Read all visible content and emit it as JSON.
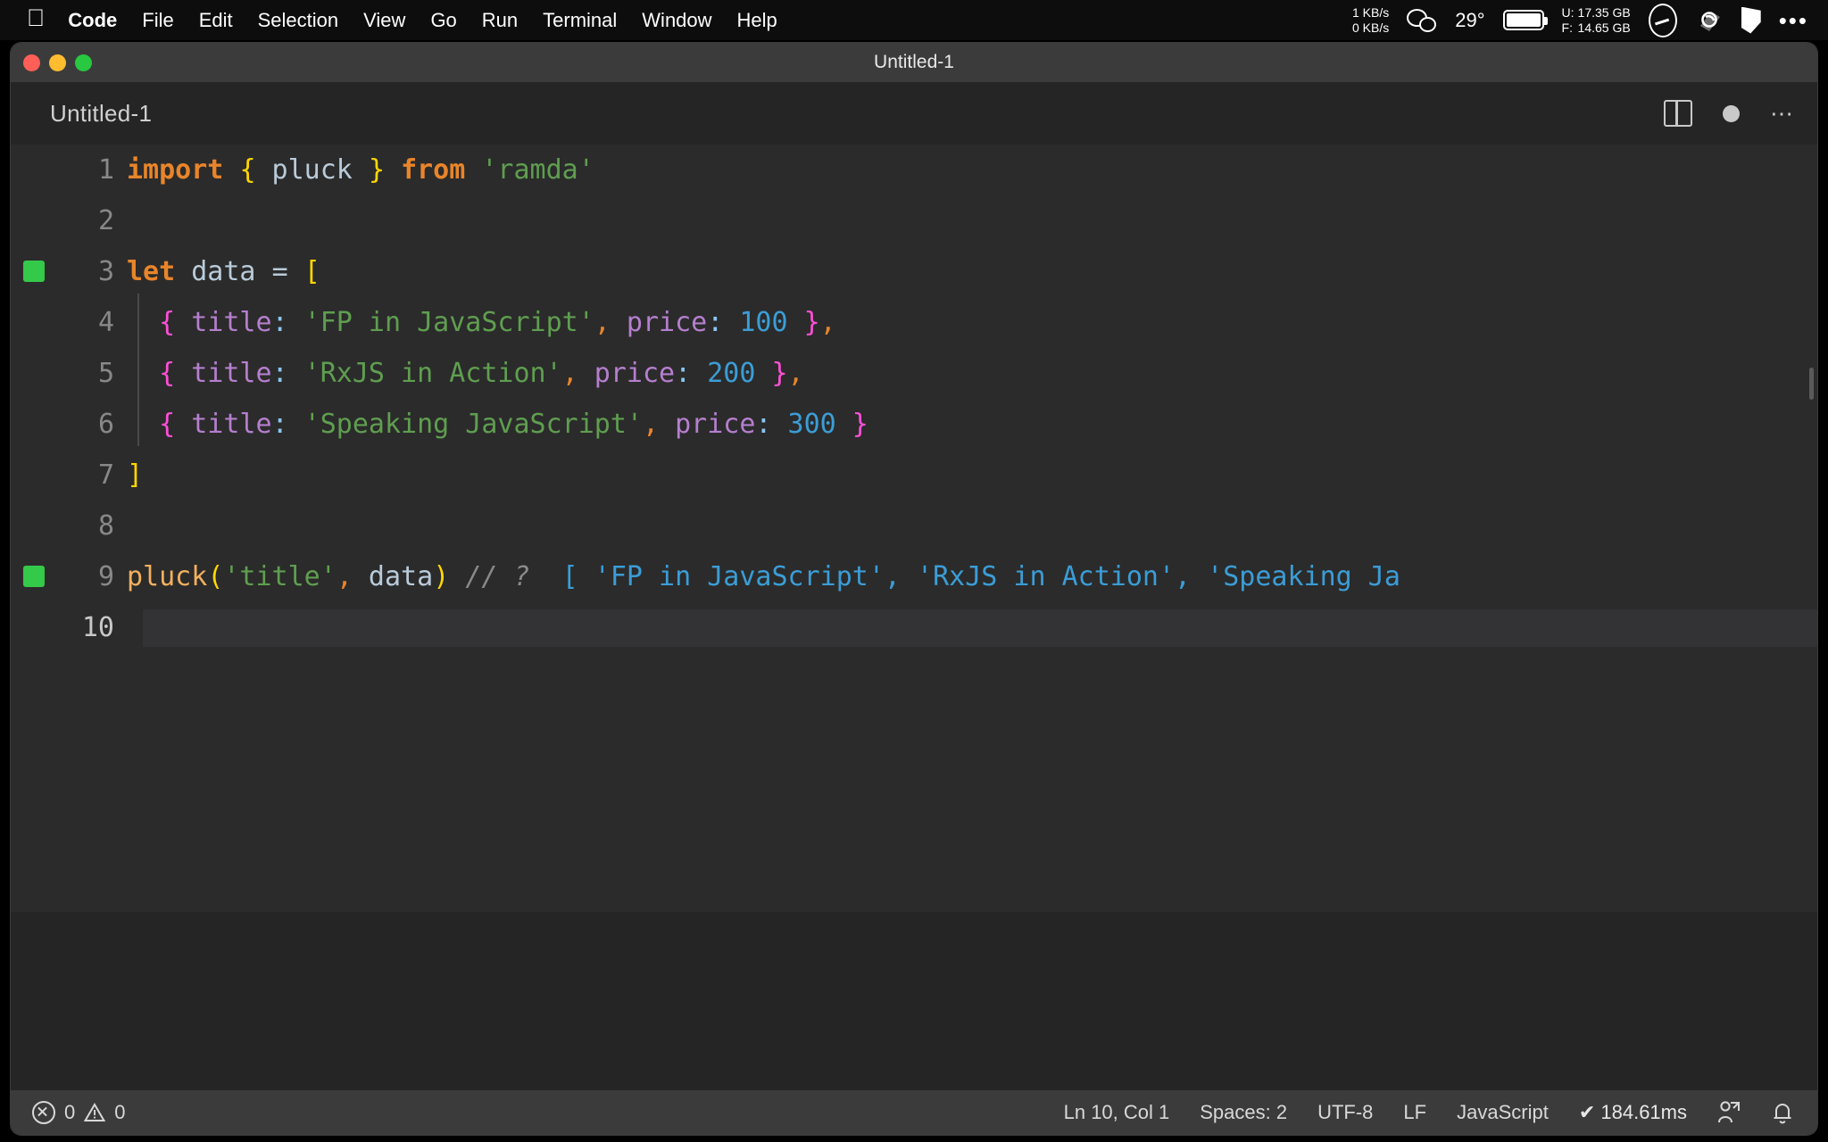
{
  "macbar": {
    "apple_logo": "apple-icon",
    "menus": [
      {
        "label": "Code",
        "bold": true
      },
      {
        "label": "File",
        "bold": false
      },
      {
        "label": "Edit",
        "bold": false
      },
      {
        "label": "Selection",
        "bold": false
      },
      {
        "label": "View",
        "bold": false
      },
      {
        "label": "Go",
        "bold": false
      },
      {
        "label": "Run",
        "bold": false
      },
      {
        "label": "Terminal",
        "bold": false
      },
      {
        "label": "Window",
        "bold": false
      },
      {
        "label": "Help",
        "bold": false
      }
    ],
    "net_up": "1 KB/s",
    "net_down": "0 KB/s",
    "wechat": "wechat-icon",
    "temperature": "29°",
    "battery": "battery-icon",
    "disk_used_label": "U:",
    "disk_used_value": "17.35 GB",
    "disk_free_label": "F:",
    "disk_free_value": "14.65 GB",
    "ellipse": "ellipse-icon",
    "link": "link-icon",
    "flag": "flag-icon",
    "more": "•••"
  },
  "window": {
    "title": "Untitled-1",
    "tab_name": "Untitled-1",
    "traffic_lights": [
      "close",
      "minimize",
      "zoom"
    ],
    "actions": [
      "split-editor",
      "unsaved-dot",
      "more-actions"
    ]
  },
  "editor": {
    "lines": [
      {
        "no": "1",
        "breakpoint": false,
        "current": false,
        "indent_guide": false,
        "tokens": [
          {
            "t": "import",
            "c": "t-kw"
          },
          {
            "t": " ",
            "c": "t-punc"
          },
          {
            "t": "{",
            "c": "b-yellow"
          },
          {
            "t": " pluck ",
            "c": "t-var"
          },
          {
            "t": "}",
            "c": "b-yellow"
          },
          {
            "t": " ",
            "c": "t-punc"
          },
          {
            "t": "from",
            "c": "t-kw"
          },
          {
            "t": " ",
            "c": "t-punc"
          },
          {
            "t": "'ramda'",
            "c": "t-str"
          }
        ]
      },
      {
        "no": "2",
        "breakpoint": false,
        "current": false,
        "indent_guide": false,
        "tokens": []
      },
      {
        "no": "3",
        "breakpoint": true,
        "current": false,
        "indent_guide": false,
        "tokens": [
          {
            "t": "let",
            "c": "t-kw"
          },
          {
            "t": " data ",
            "c": "t-var"
          },
          {
            "t": "=",
            "c": "t-punc"
          },
          {
            "t": " ",
            "c": "t-punc"
          },
          {
            "t": "[",
            "c": "b-yellow"
          }
        ]
      },
      {
        "no": "4",
        "breakpoint": false,
        "current": false,
        "indent_guide": true,
        "tokens": [
          {
            "t": "  ",
            "c": "t-punc"
          },
          {
            "t": "{",
            "c": "b-magenta"
          },
          {
            "t": " ",
            "c": "t-punc"
          },
          {
            "t": "title",
            "c": "t-prop"
          },
          {
            "t": ":",
            "c": "b-blue"
          },
          {
            "t": " ",
            "c": "t-punc"
          },
          {
            "t": "'FP in JavaScript'",
            "c": "t-str"
          },
          {
            "t": ",",
            "c": "t-comma"
          },
          {
            "t": " ",
            "c": "t-punc"
          },
          {
            "t": "price",
            "c": "t-prop"
          },
          {
            "t": ":",
            "c": "b-blue"
          },
          {
            "t": " ",
            "c": "t-punc"
          },
          {
            "t": "100",
            "c": "t-num"
          },
          {
            "t": " ",
            "c": "t-punc"
          },
          {
            "t": "}",
            "c": "b-magenta"
          },
          {
            "t": ",",
            "c": "t-comma"
          }
        ]
      },
      {
        "no": "5",
        "breakpoint": false,
        "current": false,
        "indent_guide": true,
        "tokens": [
          {
            "t": "  ",
            "c": "t-punc"
          },
          {
            "t": "{",
            "c": "b-magenta"
          },
          {
            "t": " ",
            "c": "t-punc"
          },
          {
            "t": "title",
            "c": "t-prop"
          },
          {
            "t": ":",
            "c": "b-blue"
          },
          {
            "t": " ",
            "c": "t-punc"
          },
          {
            "t": "'RxJS in Action'",
            "c": "t-str"
          },
          {
            "t": ",",
            "c": "t-comma"
          },
          {
            "t": " ",
            "c": "t-punc"
          },
          {
            "t": "price",
            "c": "t-prop"
          },
          {
            "t": ":",
            "c": "b-blue"
          },
          {
            "t": " ",
            "c": "t-punc"
          },
          {
            "t": "200",
            "c": "t-num"
          },
          {
            "t": " ",
            "c": "t-punc"
          },
          {
            "t": "}",
            "c": "b-magenta"
          },
          {
            "t": ",",
            "c": "t-comma"
          }
        ]
      },
      {
        "no": "6",
        "breakpoint": false,
        "current": false,
        "indent_guide": true,
        "tokens": [
          {
            "t": "  ",
            "c": "t-punc"
          },
          {
            "t": "{",
            "c": "b-magenta"
          },
          {
            "t": " ",
            "c": "t-punc"
          },
          {
            "t": "title",
            "c": "t-prop"
          },
          {
            "t": ":",
            "c": "b-blue"
          },
          {
            "t": " ",
            "c": "t-punc"
          },
          {
            "t": "'Speaking JavaScript'",
            "c": "t-str"
          },
          {
            "t": ",",
            "c": "t-comma"
          },
          {
            "t": " ",
            "c": "t-punc"
          },
          {
            "t": "price",
            "c": "t-prop"
          },
          {
            "t": ":",
            "c": "b-blue"
          },
          {
            "t": " ",
            "c": "t-punc"
          },
          {
            "t": "300",
            "c": "t-num"
          },
          {
            "t": " ",
            "c": "t-punc"
          },
          {
            "t": "}",
            "c": "b-magenta"
          }
        ]
      },
      {
        "no": "7",
        "breakpoint": false,
        "current": false,
        "indent_guide": false,
        "tokens": [
          {
            "t": "]",
            "c": "b-yellow"
          }
        ]
      },
      {
        "no": "8",
        "breakpoint": false,
        "current": false,
        "indent_guide": false,
        "tokens": []
      },
      {
        "no": "9",
        "breakpoint": true,
        "current": false,
        "indent_guide": false,
        "tokens": [
          {
            "t": "pluck",
            "c": "t-fn"
          },
          {
            "t": "(",
            "c": "b-yellow"
          },
          {
            "t": "'title'",
            "c": "t-str"
          },
          {
            "t": ",",
            "c": "t-comma"
          },
          {
            "t": " data",
            "c": "t-var"
          },
          {
            "t": ")",
            "c": "b-yellow"
          },
          {
            "t": " ",
            "c": "t-punc"
          },
          {
            "t": "// ?",
            "c": "t-cmt"
          },
          {
            "t": "  [ 'FP in JavaScript', 'RxJS in Action', 'Speaking Ja",
            "c": "t-hint"
          }
        ]
      },
      {
        "no": "10",
        "breakpoint": false,
        "current": true,
        "indent_guide": false,
        "tokens": []
      }
    ]
  },
  "statusbar": {
    "error_count": "0",
    "warning_count": "0",
    "cursor_position": "Ln 10, Col 1",
    "indentation": "Spaces: 2",
    "encoding": "UTF-8",
    "eol": "LF",
    "language": "JavaScript",
    "timing": "✔ 184.61ms",
    "remote_icon": "remote-person-icon",
    "bell_icon": "bell-icon"
  },
  "colors": {
    "accent_green": "#35c94a",
    "editor_bg": "#2b2b2b",
    "chrome_bg": "#3b3b3b",
    "string": "#5f9e50",
    "keyword": "#e8852a",
    "number": "#3b9dd6",
    "property": "#b57fce",
    "bracket_yellow": "#ffd700",
    "bracket_magenta": "#ff4fd8"
  }
}
